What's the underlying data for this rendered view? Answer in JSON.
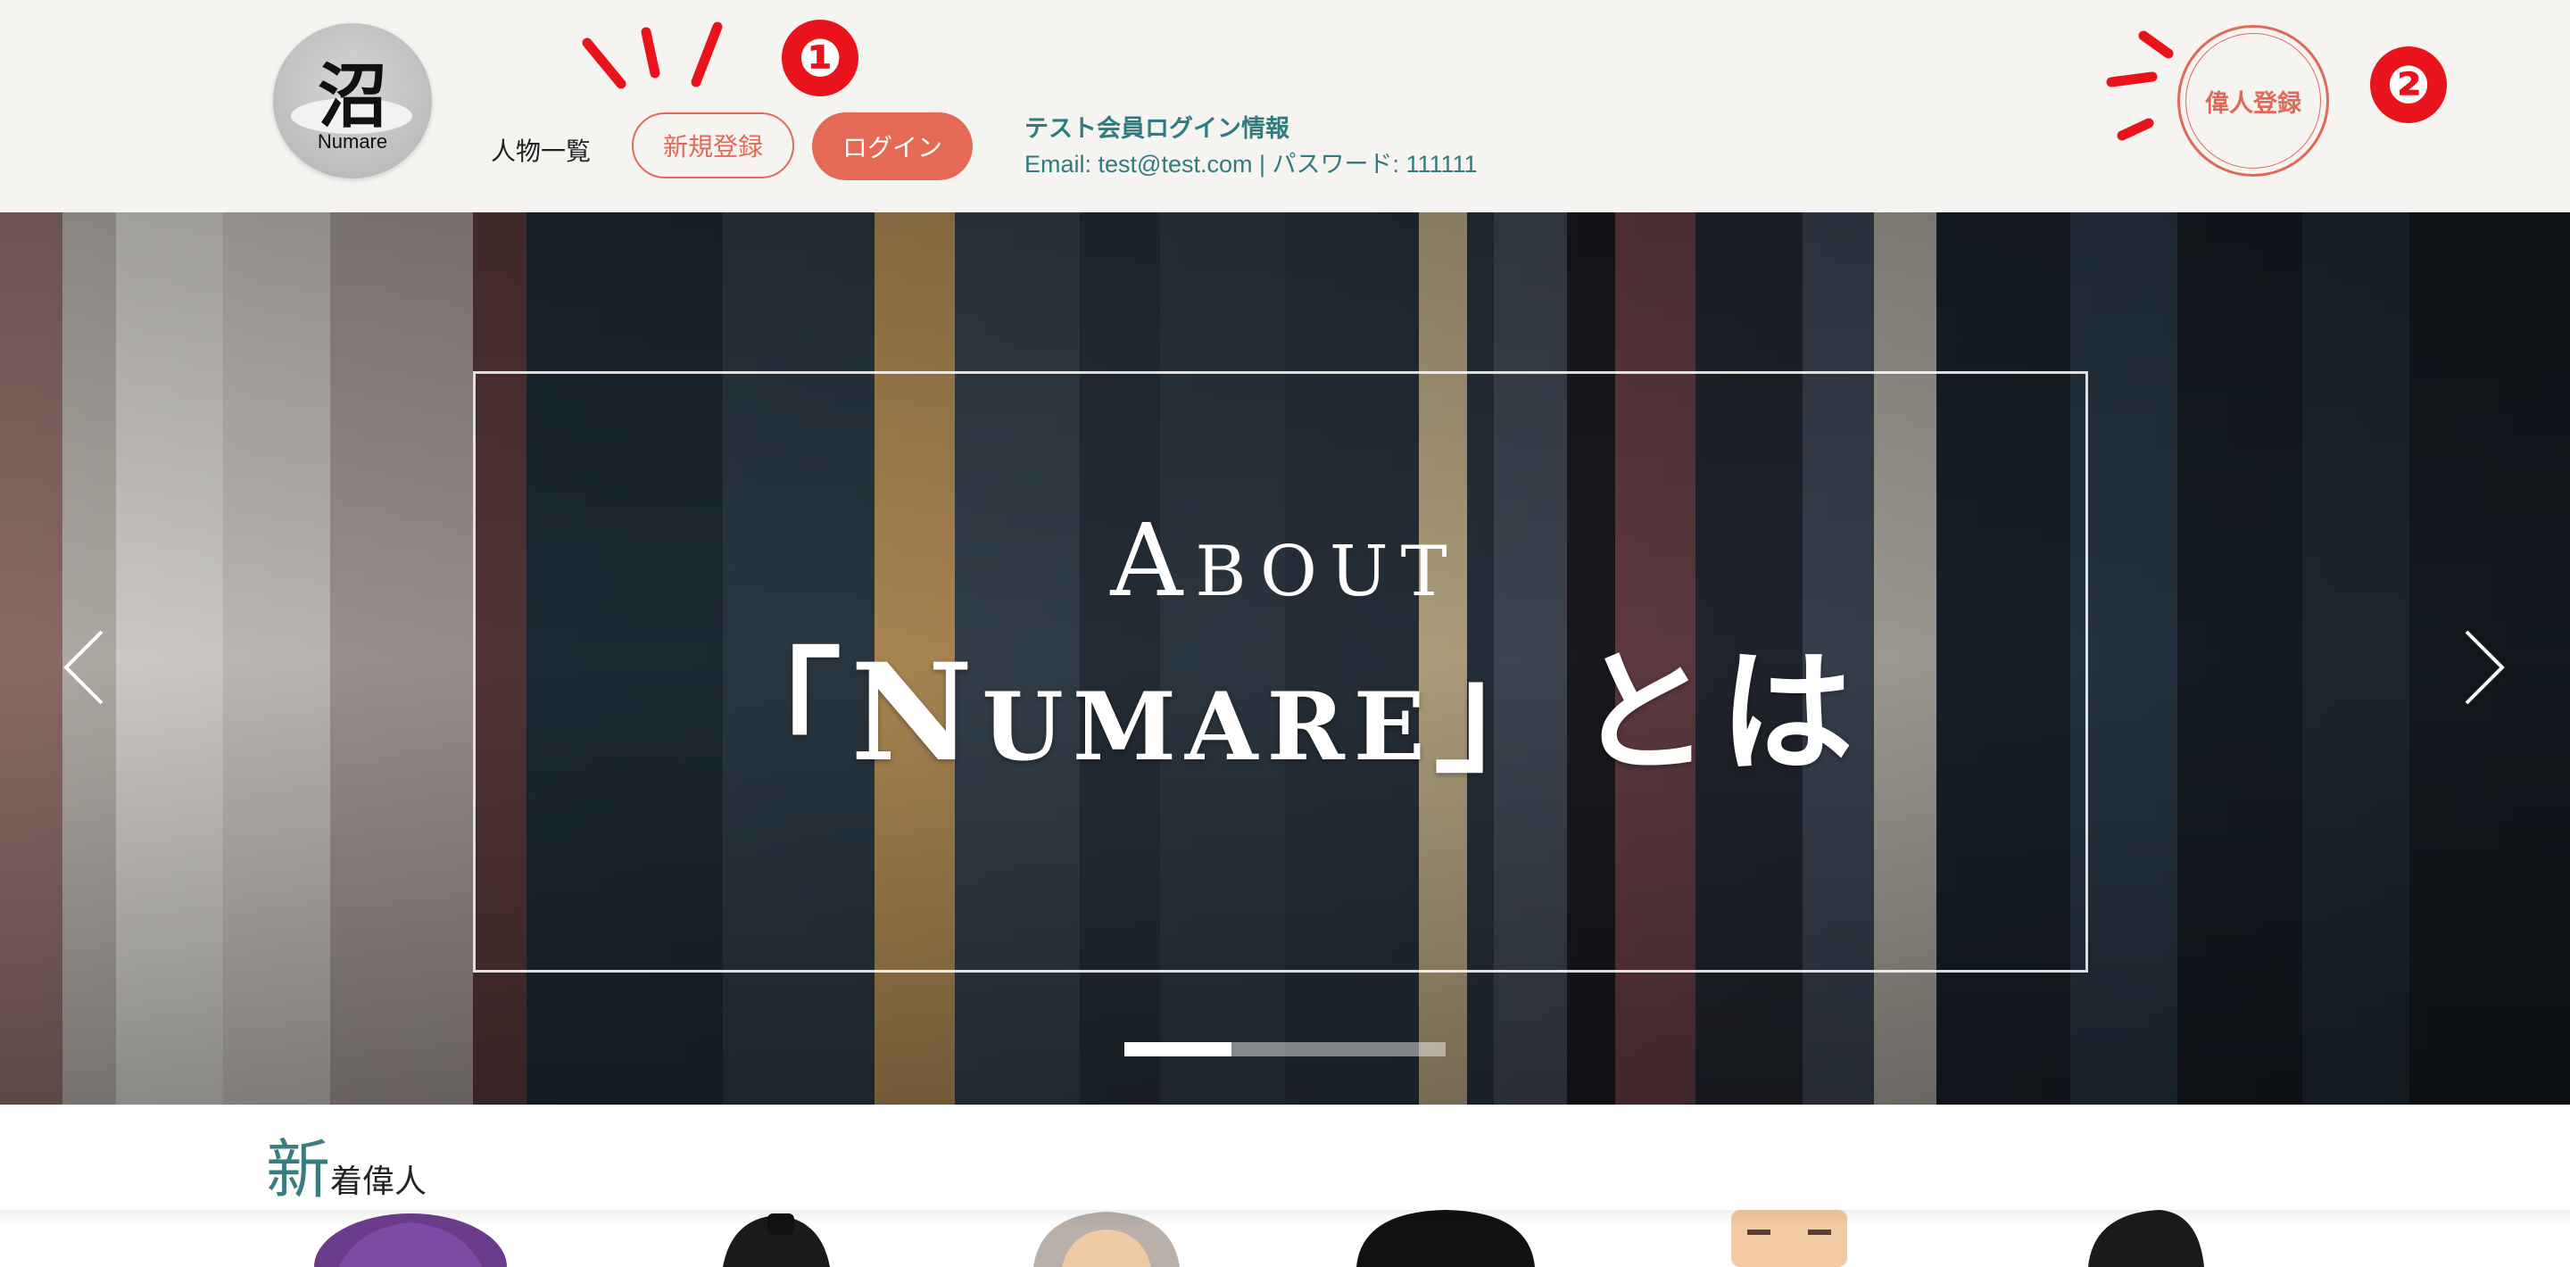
{
  "header": {
    "logo": {
      "kanji": "沼",
      "name": "Numare",
      "icon": "numare-logo"
    },
    "nav_people": "人物一覧",
    "signup_label": "新規登録",
    "login_label": "ログイン",
    "test_info": {
      "title": "テスト会員ログイン情報",
      "body": "Email: test@test.com | パスワード: 111111"
    },
    "register_person_label": "偉人登録",
    "annotations": [
      "❶",
      "❷"
    ]
  },
  "hero": {
    "eyebrow": "About",
    "title": "「Numare」とは",
    "prev_icon": "chevron-left-icon",
    "next_icon": "chevron-right-icon",
    "slides_total": 3,
    "active_slide": 1
  },
  "new_arrivals": {
    "title_big": "新",
    "title_small": "着偉人"
  },
  "colors": {
    "accent": "#e46a55",
    "teal": "#2f7c80",
    "header_bg": "#f5f4f1",
    "annotation_red": "#e8131b"
  }
}
